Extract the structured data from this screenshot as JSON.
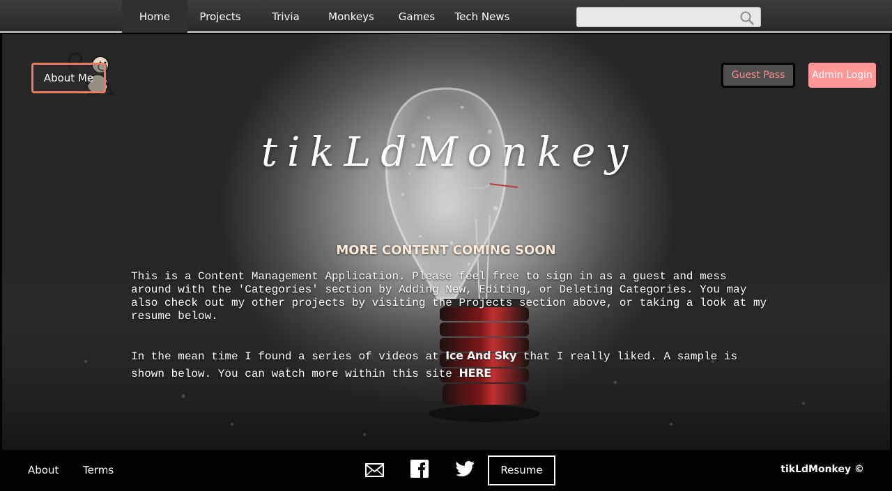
{
  "nav": {
    "items": [
      {
        "label": "Home"
      },
      {
        "label": "Projects"
      },
      {
        "label": "Trivia"
      },
      {
        "label": "Monkeys"
      },
      {
        "label": "Games"
      },
      {
        "label": "Tech News"
      }
    ],
    "search": {
      "value": "",
      "placeholder": "",
      "icon": "search-icon"
    }
  },
  "header": {
    "logo_icon": "monkey-icon",
    "about_label": "About Me",
    "guest_label": "Guest Pass",
    "admin_label": "Admin Login"
  },
  "hero": {
    "title": "tikLdMonkey",
    "coming_soon": "MORE CONTENT COMING SOON",
    "intro": "This is a Content Management Application. Please feel free to sign in as a guest and mess around with the 'Categories' section by Adding New, Editing, or Deleting Categories. You may also check out my other projects by visiting the Projects section above, or taking a look at my resume below.",
    "para2_before": "In the mean time I found a series of videos at ",
    "para2_link1": "Ice And Sky",
    "para2_middle": " that I really liked. A sample is shown below. You can watch more within this site ",
    "para2_link2": "HERE"
  },
  "footer": {
    "about_label": "About",
    "terms_label": "Terms",
    "icons": [
      "mail-icon",
      "facebook-icon",
      "twitter-icon"
    ],
    "resume_label": "Resume",
    "copyright": "tikLdMonkey ©"
  },
  "colors": {
    "accent_border": "#f07a5e",
    "guest_text": "#ff8d8d",
    "admin_bg": "#ff9797",
    "nav_bg": "#353535"
  }
}
